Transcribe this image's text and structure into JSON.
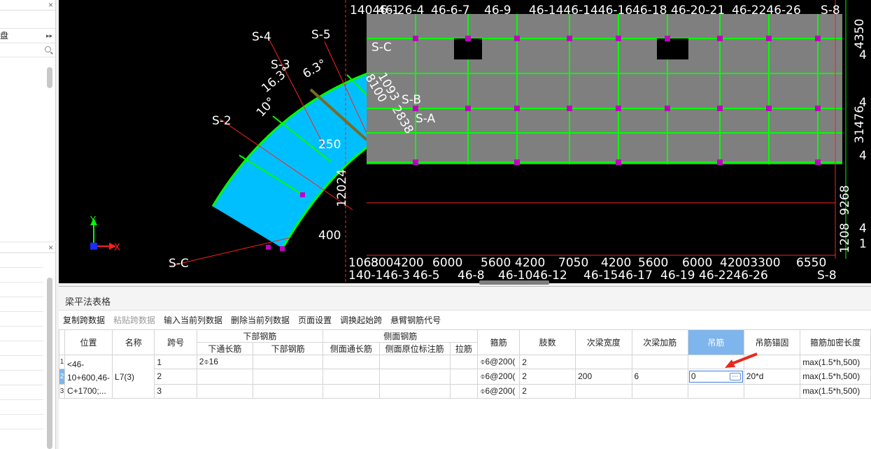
{
  "left_panel_top": {
    "close": "×",
    "item_label": "盘",
    "item_arrow": "▸▸"
  },
  "left_panel_bottom": {
    "close": "×"
  },
  "cad": {
    "colors": {
      "background": "#000000",
      "slab_cyan": "#00bfff",
      "slab_gray": "#7f7f7f",
      "beam_green": "#00ff00",
      "axis_red": "#ff2020",
      "node_magenta": "#c000c0",
      "text": "#ffffff"
    },
    "axis_labels_arc": [
      "S-4",
      "S-5",
      "S-3",
      "S-2",
      "S-C",
      "S-C",
      "S-B",
      "S-A"
    ],
    "angles": [
      "16.3°",
      "6.3°",
      "10°"
    ],
    "dims_misc": [
      "250",
      "400",
      "12024",
      "8100",
      "1093",
      "2838"
    ],
    "top_labels": [
      "14046-1",
      "46-26-4",
      "46-6-7",
      "46-9",
      "46-1446-1446-16",
      "46-18",
      "46-20-21",
      "46-2246-26",
      "S-8"
    ],
    "bottom_dims": [
      "1063",
      "8004200",
      "6000",
      "5600",
      "4200",
      "7050",
      "4200",
      "5600",
      "6000",
      "42003300",
      "6550"
    ],
    "bottom_labels": [
      "140-146-3",
      "46-5",
      "46-8",
      "46-1046-12",
      "46-1546-17",
      "46-19",
      "46-2246-26",
      "S-8"
    ],
    "right_dims": [
      "4350",
      "4",
      "4",
      "31476",
      "4",
      "9268",
      "1208",
      "4",
      "1"
    ],
    "ucs_x": "X",
    "ucs_y": "Y"
  },
  "table_panel": {
    "title": "梁平法表格",
    "toolbar": [
      {
        "label": "复制跨数据",
        "enabled": true
      },
      {
        "label": "粘贴跨数据",
        "enabled": false
      },
      {
        "label": "输入当前列数据",
        "enabled": true
      },
      {
        "label": "删除当前列数据",
        "enabled": true
      },
      {
        "label": "页面设置",
        "enabled": true
      },
      {
        "label": "调换起始跨",
        "enabled": true
      },
      {
        "label": "悬臂钢筋代号",
        "enabled": true
      }
    ],
    "headers": {
      "position": "位置",
      "name": "名称",
      "span": "跨号",
      "bottom_group": "下部钢筋",
      "bottom_through": "下通长筋",
      "bottom_bar": "下部钢筋",
      "side_group": "侧面钢筋",
      "side_through": "侧面通长筋",
      "side_original": "侧面原位标注筋",
      "tie": "拉筋",
      "stirrup": "箍筋",
      "legs": "肢数",
      "sec_beam_width": "次梁宽度",
      "sec_beam_bar": "次梁加筋",
      "hanger": "吊筋",
      "hanger_anchor": "吊筋锚固",
      "stirrup_dense_len": "箍筋加密长度"
    },
    "beam": {
      "position": "<46-10+600,46-C+1700;...",
      "name": "L7(3)"
    },
    "rows": [
      {
        "row_no": "1",
        "span": "1",
        "bottom_through": "2⌽16",
        "bottom_bar": "",
        "side_through": "",
        "side_original": "",
        "tie": "",
        "stirrup": "⌽6@200(",
        "legs": "2",
        "sec_beam_width": "",
        "sec_beam_bar": "",
        "hanger": "",
        "hanger_anchor": "",
        "dense_len": "max(1.5*h,500)"
      },
      {
        "row_no": "2",
        "span": "2",
        "bottom_through": "",
        "bottom_bar": "",
        "side_through": "",
        "side_original": "",
        "tie": "",
        "stirrup": "⌽6@200(",
        "legs": "2",
        "sec_beam_width": "200",
        "sec_beam_bar": "6",
        "hanger": "0",
        "hanger_anchor": "20*d",
        "dense_len": "max(1.5*h,500)"
      },
      {
        "row_no": "3",
        "span": "3",
        "bottom_through": "",
        "bottom_bar": "",
        "side_through": "",
        "side_original": "",
        "tie": "",
        "stirrup": "⌽6@200(",
        "legs": "2",
        "sec_beam_width": "",
        "sec_beam_bar": "",
        "hanger": "",
        "hanger_anchor": "",
        "dense_len": "max(1.5*h,500)"
      }
    ],
    "edit_button": "⋯",
    "highlight_color": "#7eb5ec",
    "arrow_color": "#e8281e"
  }
}
